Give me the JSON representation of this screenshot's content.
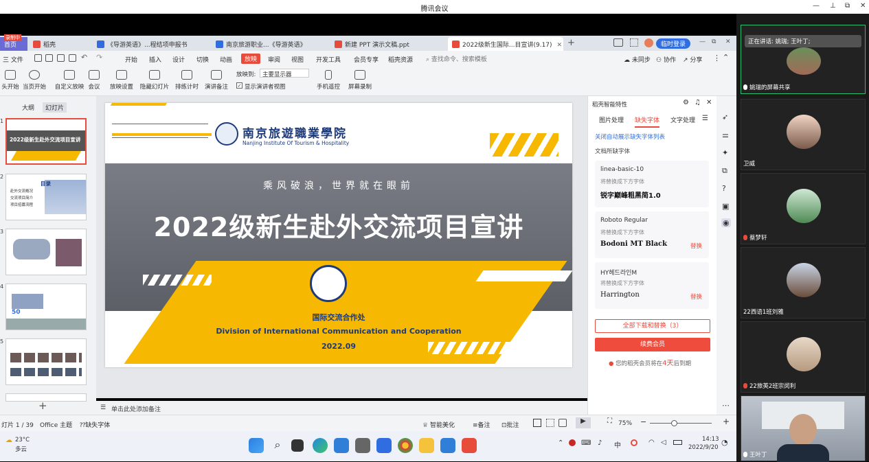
{
  "meeting": {
    "title": "腾讯会议",
    "speaking": "正在讲话: 姚瑞; 王叶丁;",
    "participants": [
      {
        "name": "姚瑞的屏幕共享"
      },
      {
        "name": "卫威"
      },
      {
        "name": "蔡梦轩"
      },
      {
        "name": "22西语1班刘雅"
      },
      {
        "name": "22旅英2班宗闵利"
      },
      {
        "name": "王叶丁"
      }
    ]
  },
  "tabs": {
    "home": "首页",
    "recording": "录制中",
    "t1": "稻壳",
    "t2": "《导游英语》...程结项申报书",
    "t3": "南京旅游职业...《导游英语》",
    "t4": "新建 PPT 演示文稿.ppt",
    "t5": "2022级新生国际...目宣讲(9.17)",
    "login": "临时登录"
  },
  "menu": {
    "file": "三 文件",
    "items": [
      "开始",
      "插入",
      "设计",
      "切换",
      "动画",
      "放映",
      "审阅",
      "视图",
      "开发工具",
      "会员专享",
      "稻壳资源"
    ],
    "search": "查找命令、搜索模板",
    "sync": "未同步",
    "collab": "协作",
    "share": "分享"
  },
  "ribbon": {
    "buttons": [
      "头开始",
      "当页开始",
      "自定义放映",
      "会议",
      "放映设置",
      "隐藏幻灯片",
      "排练计时",
      "演讲备注",
      "手机遥控",
      "屏幕录制"
    ],
    "show_on_label": "放映到:",
    "show_on_value": "主要显示器",
    "presenter_view": "显示演讲者视图"
  },
  "left_panel": {
    "tab_outline": "大纲",
    "tab_slides": "幻灯片",
    "numbers": [
      "1",
      "2",
      "3",
      "4",
      "5"
    ],
    "thumb1_title": "2022级新生赴外交流项目宣讲",
    "thumb2_title": "目录",
    "thumb2_items": [
      "赴外交流概况",
      "交流项目简介",
      "项目招募流程"
    ]
  },
  "slide": {
    "school_cn": "南京旅遊職業學院",
    "school_en": "Nanjing Institute Of Tourism & Hospitality",
    "slogan": "乘风破浪，世界就在眼前",
    "title": "2022级新生赴外交流项目宣讲",
    "dept_cn": "国际交流合作处",
    "dept_en": "Division of International Communication and Cooperation",
    "date": "2022.09"
  },
  "notes_placeholder": "单击此处添加备注",
  "right_panel": {
    "header": "稻壳智能特性",
    "tabs": [
      "图片处理",
      "缺失字体",
      "文字处理"
    ],
    "close_auto": "关闭自动展示缺失字体列表",
    "missing_title": "文档所缺字体",
    "replace_with": "将替换成下方字体",
    "fonts": [
      {
        "name": "linea-basic-10",
        "replacement": "锐字巅峰粗黑简1.0",
        "link": ""
      },
      {
        "name": "Roboto Regular",
        "replacement": "Bodoni MT Black",
        "link": "替换"
      },
      {
        "name": "HY헤드라인M",
        "replacement": "Harrington",
        "link": "替换"
      }
    ],
    "download_all": "全部下载和替换（3）",
    "renew": "续费会员",
    "expire_prefix": "您的稻壳会员将在",
    "expire_days": "4天",
    "expire_suffix": "后到期"
  },
  "status": {
    "slide_count": "灯片 1 / 39",
    "theme": "Office 主题",
    "missing_font": "缺失字体",
    "beautify": "智能美化",
    "notes": "备注",
    "comment": "批注",
    "zoom": "75%"
  },
  "taskbar": {
    "temp": "23°C",
    "weather": "多云",
    "time": "14:13",
    "date": "2022/9/20",
    "ime": "中"
  },
  "colors": {
    "accent_red": "#e74b3c",
    "slide_yellow": "#f6b800",
    "slide_blue": "#1d3a7a"
  }
}
